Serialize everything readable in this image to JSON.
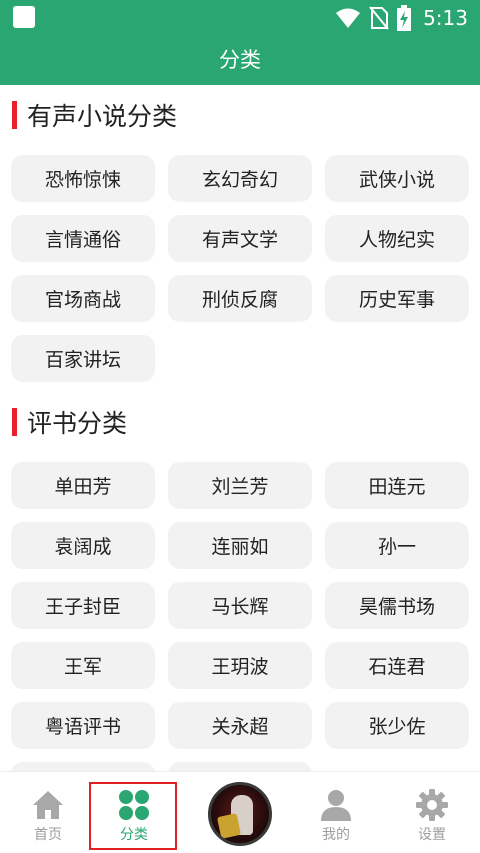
{
  "status_bar": {
    "time": "5:13"
  },
  "app_bar": {
    "title": "分类"
  },
  "sections": [
    {
      "title": "有声小说分类",
      "items": [
        "恐怖惊悚",
        "玄幻奇幻",
        "武侠小说",
        "言情通俗",
        "有声文学",
        "人物纪实",
        "官场商战",
        "刑侦反腐",
        "历史军事",
        "百家讲坛"
      ]
    },
    {
      "title": "评书分类",
      "items": [
        "单田芳",
        "刘兰芳",
        "田连元",
        "袁阔成",
        "连丽如",
        "孙一",
        "王子封臣",
        "马长辉",
        "昊儒书场",
        "王军",
        "王玥波",
        "石连君",
        "粤语评书",
        "关永超",
        "张少佐"
      ]
    }
  ],
  "bottom_nav": {
    "items": [
      {
        "label": "首页",
        "icon": "home-icon",
        "active": false
      },
      {
        "label": "分类",
        "icon": "grid-icon",
        "active": true
      },
      {
        "label": "",
        "icon": "album-cover",
        "active": false
      },
      {
        "label": "我的",
        "icon": "person-icon",
        "active": false
      },
      {
        "label": "设置",
        "icon": "gear-icon",
        "active": false
      }
    ]
  },
  "colors": {
    "primary": "#2aa672",
    "accent_bar": "#e8202a",
    "chip_bg": "#f2f2f2",
    "nav_inactive": "#9e9e9e",
    "highlight": "#e02020"
  }
}
